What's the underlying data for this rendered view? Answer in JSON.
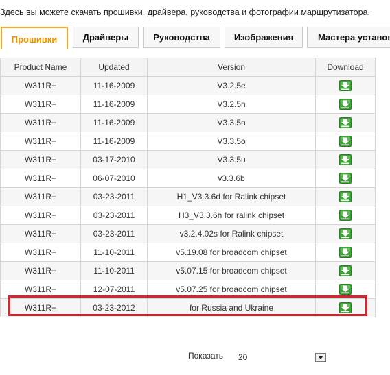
{
  "intro_text": "Здесь вы можете скачать прошивки, драйвера, руководства и фотографии маршрутизатора.",
  "tabs": [
    {
      "label": "Прошивки",
      "active": true
    },
    {
      "label": "Драйверы",
      "active": false
    },
    {
      "label": "Руководства",
      "active": false
    },
    {
      "label": "Изображения",
      "active": false
    },
    {
      "label": "Мастера установ",
      "active": false
    }
  ],
  "table": {
    "headers": [
      "Product Name",
      "Updated",
      "Version",
      "Download"
    ],
    "rows": [
      {
        "product": "W311R+",
        "updated": "11-16-2009",
        "version": "V3.2.5e"
      },
      {
        "product": "W311R+",
        "updated": "11-16-2009",
        "version": "V3.2.5n"
      },
      {
        "product": "W311R+",
        "updated": "11-16-2009",
        "version": "V3.3.5n"
      },
      {
        "product": "W311R+",
        "updated": "11-16-2009",
        "version": "V3.3.5o"
      },
      {
        "product": "W311R+",
        "updated": "03-17-2010",
        "version": "V3.3.5u"
      },
      {
        "product": "W311R+",
        "updated": "06-07-2010",
        "version": "v3.3.6b"
      },
      {
        "product": "W311R+",
        "updated": "03-23-2011",
        "version": "H1_V3.3.6d for Ralink chipset"
      },
      {
        "product": "W311R+",
        "updated": "03-23-2011",
        "version": "H3_V3.3.6h for ralink chipset"
      },
      {
        "product": "W311R+",
        "updated": "03-23-2011",
        "version": "v3.2.4.02s for Ralink chipset"
      },
      {
        "product": "W311R+",
        "updated": "11-10-2011",
        "version": "v5.19.08 for broadcom chipset"
      },
      {
        "product": "W311R+",
        "updated": "11-10-2011",
        "version": "v5.07.15 for broadcom chipset"
      },
      {
        "product": "W311R+",
        "updated": "12-07-2011",
        "version": "v5.07.25 for broadcom chipset"
      },
      {
        "product": "W311R+",
        "updated": "03-23-2012",
        "version": "for Russia and Ukraine"
      }
    ],
    "download_icon": "download-arrow-icon",
    "highlighted_row_index": 12
  },
  "pager": {
    "label": "Показать",
    "value": "20"
  },
  "colors": {
    "accent": "#f39200",
    "tab_border_active": "#f5a623",
    "highlight": "#d9232d",
    "download_green": "#3aa535"
  }
}
